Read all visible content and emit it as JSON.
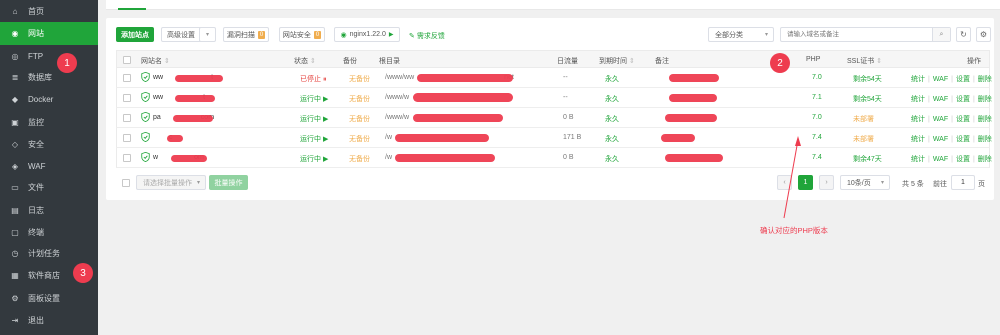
{
  "sidebar": {
    "items": [
      {
        "label": "首页",
        "icon": "home-icon",
        "glyph": "⌂"
      },
      {
        "label": "网站",
        "icon": "globe-icon",
        "glyph": "◉",
        "active": true
      },
      {
        "label": "FTP",
        "icon": "ftp-icon",
        "glyph": "◎"
      },
      {
        "label": "数据库",
        "icon": "database-icon",
        "glyph": "≣"
      },
      {
        "label": "Docker",
        "icon": "docker-icon",
        "glyph": "◆"
      },
      {
        "label": "监控",
        "icon": "monitor-icon",
        "glyph": "▣"
      },
      {
        "label": "安全",
        "icon": "shield-icon",
        "glyph": "◇"
      },
      {
        "label": "WAF",
        "icon": "waf-icon",
        "glyph": "◈"
      },
      {
        "label": "文件",
        "icon": "folder-icon",
        "glyph": "▭"
      },
      {
        "label": "日志",
        "icon": "log-icon",
        "glyph": "▤"
      },
      {
        "label": "终端",
        "icon": "terminal-icon",
        "glyph": "▢"
      },
      {
        "label": "计划任务",
        "icon": "clock-icon",
        "glyph": "◷"
      },
      {
        "label": "软件商店",
        "icon": "grid-icon",
        "glyph": "▦"
      },
      {
        "label": "面板设置",
        "icon": "gear-icon",
        "glyph": "⚙"
      },
      {
        "label": "退出",
        "icon": "logout-icon",
        "glyph": "⇥"
      }
    ]
  },
  "toolbar": {
    "add_site": "添加站点",
    "advanced": "高级设置",
    "vuln_scan": "漏洞扫描",
    "vuln_count": "0",
    "site_security": "网站安全",
    "security_count": "0",
    "nginx": "nginx1.22.0",
    "feedback": "需求反馈",
    "category": "全部分类",
    "search_placeholder": "请输入域名或备注"
  },
  "table": {
    "headers": {
      "name": "网站名",
      "status": "状态",
      "backup": "备份",
      "root": "根目录",
      "traffic": "日流量",
      "expire": "到期时间",
      "remark": "备注",
      "php": "PHP",
      "ssl": "SSL证书",
      "ops": "操作"
    },
    "rows": [
      {
        "name": "ww",
        "name_tail": "t",
        "status": "已停止",
        "status_icon": "⏸",
        "status_color": "red",
        "backup": "无备份",
        "root": "/www/ww",
        "root_tail": "net",
        "traffic": "--",
        "expire": "永久",
        "php": "7.0",
        "ssl": "剩余54天",
        "ssl_color": "green"
      },
      {
        "name": "ww",
        "name_tail": "t",
        "status": "运行中",
        "status_icon": "▶",
        "status_color": "green",
        "backup": "无备份",
        "root": "/www/w",
        "root_tail": "",
        "traffic": "--",
        "expire": "永久",
        "php": "7.1",
        "ssl": "剩余54天",
        "ssl_color": "green"
      },
      {
        "name": "pa",
        "name_tail": "com",
        "status": "运行中",
        "status_icon": "▶",
        "status_color": "green",
        "backup": "无备份",
        "root": "/www/w",
        "root_tail": "",
        "traffic": "0 B",
        "expire": "永久",
        "php": "7.0",
        "ssl": "未部署",
        "ssl_color": "orange"
      },
      {
        "name": "",
        "name_tail": "c",
        "status": "运行中",
        "status_icon": "▶",
        "status_color": "green",
        "backup": "无备份",
        "root": "/w",
        "root_tail": "",
        "traffic": "171 B",
        "expire": "永久",
        "php": "7.4",
        "ssl": "未部署",
        "ssl_color": "orange"
      },
      {
        "name": "w",
        "name_tail": "om",
        "status": "运行中",
        "status_icon": "▶",
        "status_color": "green",
        "backup": "无备份",
        "root": "/w",
        "root_tail": "",
        "traffic": "0 B",
        "expire": "永久",
        "php": "7.4",
        "ssl": "剩余47天",
        "ssl_color": "green"
      }
    ],
    "ops": [
      "统计",
      "WAF",
      "设置",
      "删除"
    ]
  },
  "footer": {
    "batch_placeholder": "请选择批量操作",
    "batch_btn": "批量操作",
    "page_current": "1",
    "page_size": "10条/页",
    "total": "共 5 条",
    "goto_label": "前往",
    "goto_value": "1",
    "page_unit": "页"
  },
  "annotations": {
    "m1": "1",
    "m2": "2",
    "m3": "3",
    "note": "确认对应的PHP版本"
  },
  "colors": {
    "brand": "#20a53a",
    "sidebar_bg": "#33393e",
    "annotation": "#ee3c4f"
  }
}
